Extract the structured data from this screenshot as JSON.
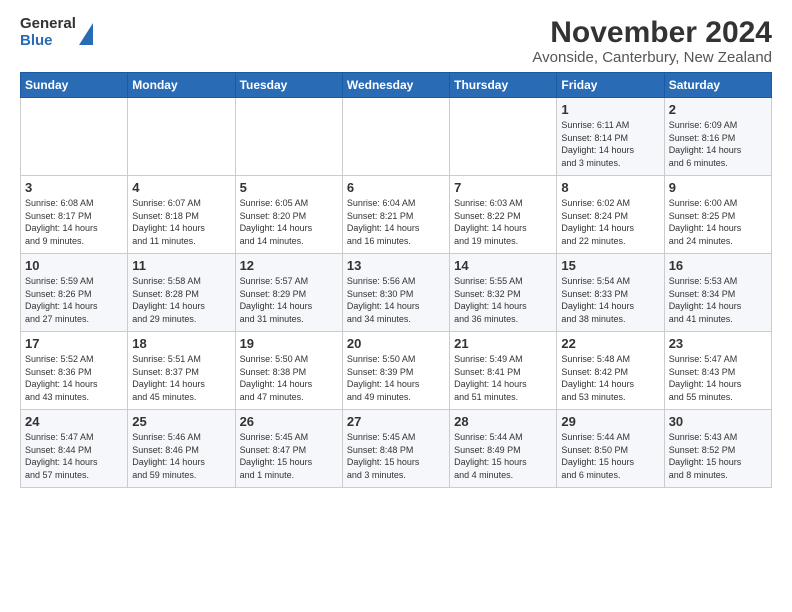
{
  "logo": {
    "general": "General",
    "blue": "Blue"
  },
  "title": "November 2024",
  "subtitle": "Avonside, Canterbury, New Zealand",
  "headers": [
    "Sunday",
    "Monday",
    "Tuesday",
    "Wednesday",
    "Thursday",
    "Friday",
    "Saturday"
  ],
  "weeks": [
    [
      {
        "day": "",
        "info": ""
      },
      {
        "day": "",
        "info": ""
      },
      {
        "day": "",
        "info": ""
      },
      {
        "day": "",
        "info": ""
      },
      {
        "day": "",
        "info": ""
      },
      {
        "day": "1",
        "info": "Sunrise: 6:11 AM\nSunset: 8:14 PM\nDaylight: 14 hours\nand 3 minutes."
      },
      {
        "day": "2",
        "info": "Sunrise: 6:09 AM\nSunset: 8:16 PM\nDaylight: 14 hours\nand 6 minutes."
      }
    ],
    [
      {
        "day": "3",
        "info": "Sunrise: 6:08 AM\nSunset: 8:17 PM\nDaylight: 14 hours\nand 9 minutes."
      },
      {
        "day": "4",
        "info": "Sunrise: 6:07 AM\nSunset: 8:18 PM\nDaylight: 14 hours\nand 11 minutes."
      },
      {
        "day": "5",
        "info": "Sunrise: 6:05 AM\nSunset: 8:20 PM\nDaylight: 14 hours\nand 14 minutes."
      },
      {
        "day": "6",
        "info": "Sunrise: 6:04 AM\nSunset: 8:21 PM\nDaylight: 14 hours\nand 16 minutes."
      },
      {
        "day": "7",
        "info": "Sunrise: 6:03 AM\nSunset: 8:22 PM\nDaylight: 14 hours\nand 19 minutes."
      },
      {
        "day": "8",
        "info": "Sunrise: 6:02 AM\nSunset: 8:24 PM\nDaylight: 14 hours\nand 22 minutes."
      },
      {
        "day": "9",
        "info": "Sunrise: 6:00 AM\nSunset: 8:25 PM\nDaylight: 14 hours\nand 24 minutes."
      }
    ],
    [
      {
        "day": "10",
        "info": "Sunrise: 5:59 AM\nSunset: 8:26 PM\nDaylight: 14 hours\nand 27 minutes."
      },
      {
        "day": "11",
        "info": "Sunrise: 5:58 AM\nSunset: 8:28 PM\nDaylight: 14 hours\nand 29 minutes."
      },
      {
        "day": "12",
        "info": "Sunrise: 5:57 AM\nSunset: 8:29 PM\nDaylight: 14 hours\nand 31 minutes."
      },
      {
        "day": "13",
        "info": "Sunrise: 5:56 AM\nSunset: 8:30 PM\nDaylight: 14 hours\nand 34 minutes."
      },
      {
        "day": "14",
        "info": "Sunrise: 5:55 AM\nSunset: 8:32 PM\nDaylight: 14 hours\nand 36 minutes."
      },
      {
        "day": "15",
        "info": "Sunrise: 5:54 AM\nSunset: 8:33 PM\nDaylight: 14 hours\nand 38 minutes."
      },
      {
        "day": "16",
        "info": "Sunrise: 5:53 AM\nSunset: 8:34 PM\nDaylight: 14 hours\nand 41 minutes."
      }
    ],
    [
      {
        "day": "17",
        "info": "Sunrise: 5:52 AM\nSunset: 8:36 PM\nDaylight: 14 hours\nand 43 minutes."
      },
      {
        "day": "18",
        "info": "Sunrise: 5:51 AM\nSunset: 8:37 PM\nDaylight: 14 hours\nand 45 minutes."
      },
      {
        "day": "19",
        "info": "Sunrise: 5:50 AM\nSunset: 8:38 PM\nDaylight: 14 hours\nand 47 minutes."
      },
      {
        "day": "20",
        "info": "Sunrise: 5:50 AM\nSunset: 8:39 PM\nDaylight: 14 hours\nand 49 minutes."
      },
      {
        "day": "21",
        "info": "Sunrise: 5:49 AM\nSunset: 8:41 PM\nDaylight: 14 hours\nand 51 minutes."
      },
      {
        "day": "22",
        "info": "Sunrise: 5:48 AM\nSunset: 8:42 PM\nDaylight: 14 hours\nand 53 minutes."
      },
      {
        "day": "23",
        "info": "Sunrise: 5:47 AM\nSunset: 8:43 PM\nDaylight: 14 hours\nand 55 minutes."
      }
    ],
    [
      {
        "day": "24",
        "info": "Sunrise: 5:47 AM\nSunset: 8:44 PM\nDaylight: 14 hours\nand 57 minutes."
      },
      {
        "day": "25",
        "info": "Sunrise: 5:46 AM\nSunset: 8:46 PM\nDaylight: 14 hours\nand 59 minutes."
      },
      {
        "day": "26",
        "info": "Sunrise: 5:45 AM\nSunset: 8:47 PM\nDaylight: 15 hours\nand 1 minute."
      },
      {
        "day": "27",
        "info": "Sunrise: 5:45 AM\nSunset: 8:48 PM\nDaylight: 15 hours\nand 3 minutes."
      },
      {
        "day": "28",
        "info": "Sunrise: 5:44 AM\nSunset: 8:49 PM\nDaylight: 15 hours\nand 4 minutes."
      },
      {
        "day": "29",
        "info": "Sunrise: 5:44 AM\nSunset: 8:50 PM\nDaylight: 15 hours\nand 6 minutes."
      },
      {
        "day": "30",
        "info": "Sunrise: 5:43 AM\nSunset: 8:52 PM\nDaylight: 15 hours\nand 8 minutes."
      }
    ]
  ]
}
